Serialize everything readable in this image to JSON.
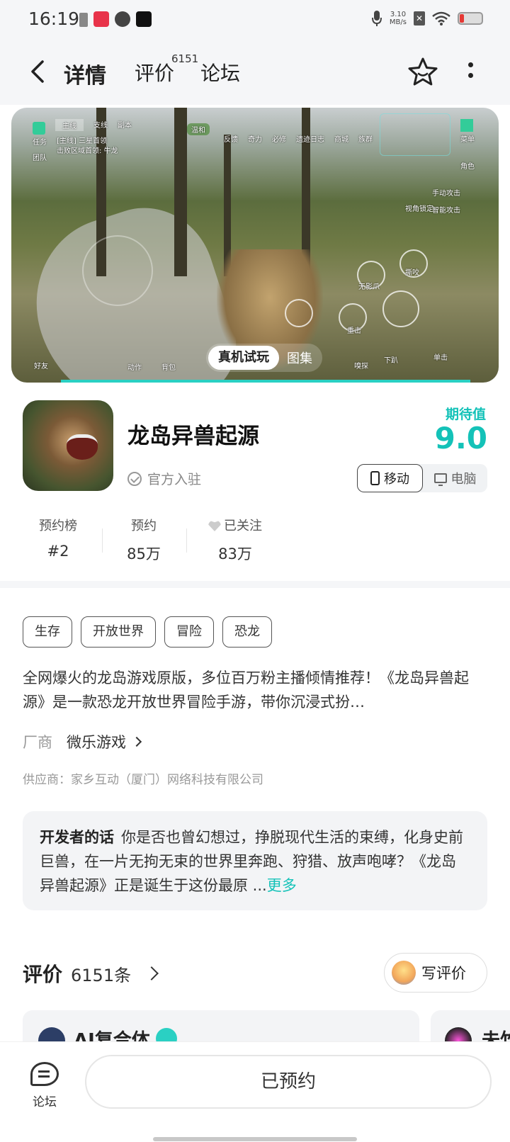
{
  "status_bar": {
    "time": "16:19",
    "net_speed_value": "3.10",
    "net_speed_unit": "MB/s",
    "icons": [
      "sim-icon",
      "app-notification-icon",
      "browser-icon",
      "tiktok-icon",
      "mic-icon",
      "wifi-icon",
      "battery-icon"
    ],
    "battery_color": "#e53935"
  },
  "header": {
    "tabs": [
      {
        "label": "详情",
        "active": true
      },
      {
        "label": "评价",
        "count": "6151"
      },
      {
        "label": "论坛"
      }
    ],
    "accent": "#2ad0c3"
  },
  "hero": {
    "try_label": "真机试玩",
    "gallery_label": "图集",
    "hud": {
      "tabs": [
        "主线",
        "支线",
        "副本"
      ],
      "quest_title": "[主线] 三星首领",
      "quest_desc": "击败区域首领: 牛龙",
      "task_label": "任务",
      "team_label": "团队",
      "weather": "温和",
      "top_labels": [
        "反馈",
        "奇力",
        "必修",
        "遗迹日志",
        "商城",
        "族群"
      ],
      "menu_label": "菜单",
      "role_label": "角色",
      "attack_manual": "手动攻击",
      "attack_smart": "智能攻击",
      "view_lock": "视角锁定",
      "skill_labels": [
        "撕咬",
        "无影爪",
        "重击",
        "下趴",
        "嗅探",
        "单击"
      ],
      "bottom_labels": [
        "好友",
        "动作",
        "背包"
      ]
    }
  },
  "game": {
    "title": "龙岛异兽起源",
    "official": "官方入驻",
    "expect_label": "期待值",
    "expect_score": "9.0",
    "platforms": [
      {
        "label": "移动",
        "active": true
      },
      {
        "label": "电脑",
        "active": false
      }
    ],
    "brand_color": "#14c2b8"
  },
  "stats": [
    {
      "label": "预约榜",
      "value": "#2"
    },
    {
      "label": "预约",
      "value": "85万"
    },
    {
      "label": "已关注",
      "value": "83万"
    }
  ],
  "tags": [
    "生存",
    "开放世界",
    "冒险",
    "恐龙"
  ],
  "description": "全网爆火的龙岛游戏原版，多位百万粉主播倾情推荐！《龙岛异兽起源》是一款恐龙开放世界冒险手游，带你沉浸式扮…",
  "maker": {
    "key": "厂商",
    "value": "微乐游戏"
  },
  "supplier": "供应商：家乡互动（厦门）网络科技有限公司",
  "developer": {
    "label": "开发者的话",
    "text": "你是否也曾幻想过，挣脱现代生活的束缚，化身史前巨兽，在一片无拘无束的世界里奔跑、狩猎、放声咆哮？《龙岛异兽起源》正是诞生于这份最原 ...",
    "more": "更多"
  },
  "reviews": {
    "title": "评价",
    "count": "6151条",
    "write_label": "写评价",
    "cards": [
      {
        "name": "AI复合体"
      },
      {
        "name": "未竹"
      }
    ]
  },
  "bottom_bar": {
    "forum_label": "论坛",
    "reserve_label": "已预约"
  }
}
